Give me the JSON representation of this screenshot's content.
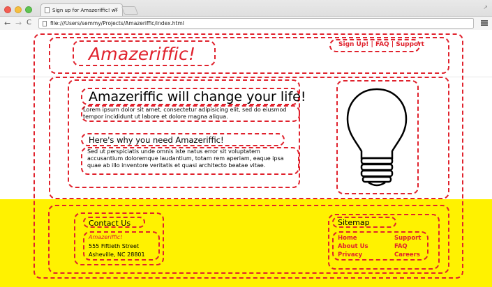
{
  "browser": {
    "tab_title": "Sign up for Amazeriffic! wi",
    "tab_close": "×",
    "url": "file:///Users/semmy/Projects/Amazeriffic/index.html",
    "back": "←",
    "forward": "→",
    "reload": "C",
    "fullscreen": "↗"
  },
  "header": {
    "logo": "Amazeriffic!",
    "nav": "Sign Up! | FAQ | Support"
  },
  "main": {
    "title": "Amazeriffic will change your life!",
    "intro": "Lorem ipsum dolor sit amet, consectetur adipisicing elit, sed do eiusmod tempor incididunt ut labore et dolore magna aliqua.",
    "why_title": "Here's why you need Amazeriffic!",
    "why_text": "Sed ut perspiciatis unde omnis iste natus error sit voluptatem accusantium doloremque laudantium, totam rem aperiam, eaque ipsa quae ab illo inventore veritatis et quasi architecto beatae vitae.",
    "image": "lightbulb-icon"
  },
  "footer": {
    "contact": {
      "title": "Contact Us",
      "company": "Amazeriffic!",
      "street": "555 Fiftieth Street",
      "city": "Asheville, NC 28801"
    },
    "sitemap": {
      "title": "Sitemap",
      "links": [
        "Home",
        "About Us",
        "Privacy",
        "Support",
        "FAQ",
        "Careers"
      ]
    }
  },
  "colors": {
    "accent": "#e0222d",
    "footer_bg": "#fff200"
  }
}
